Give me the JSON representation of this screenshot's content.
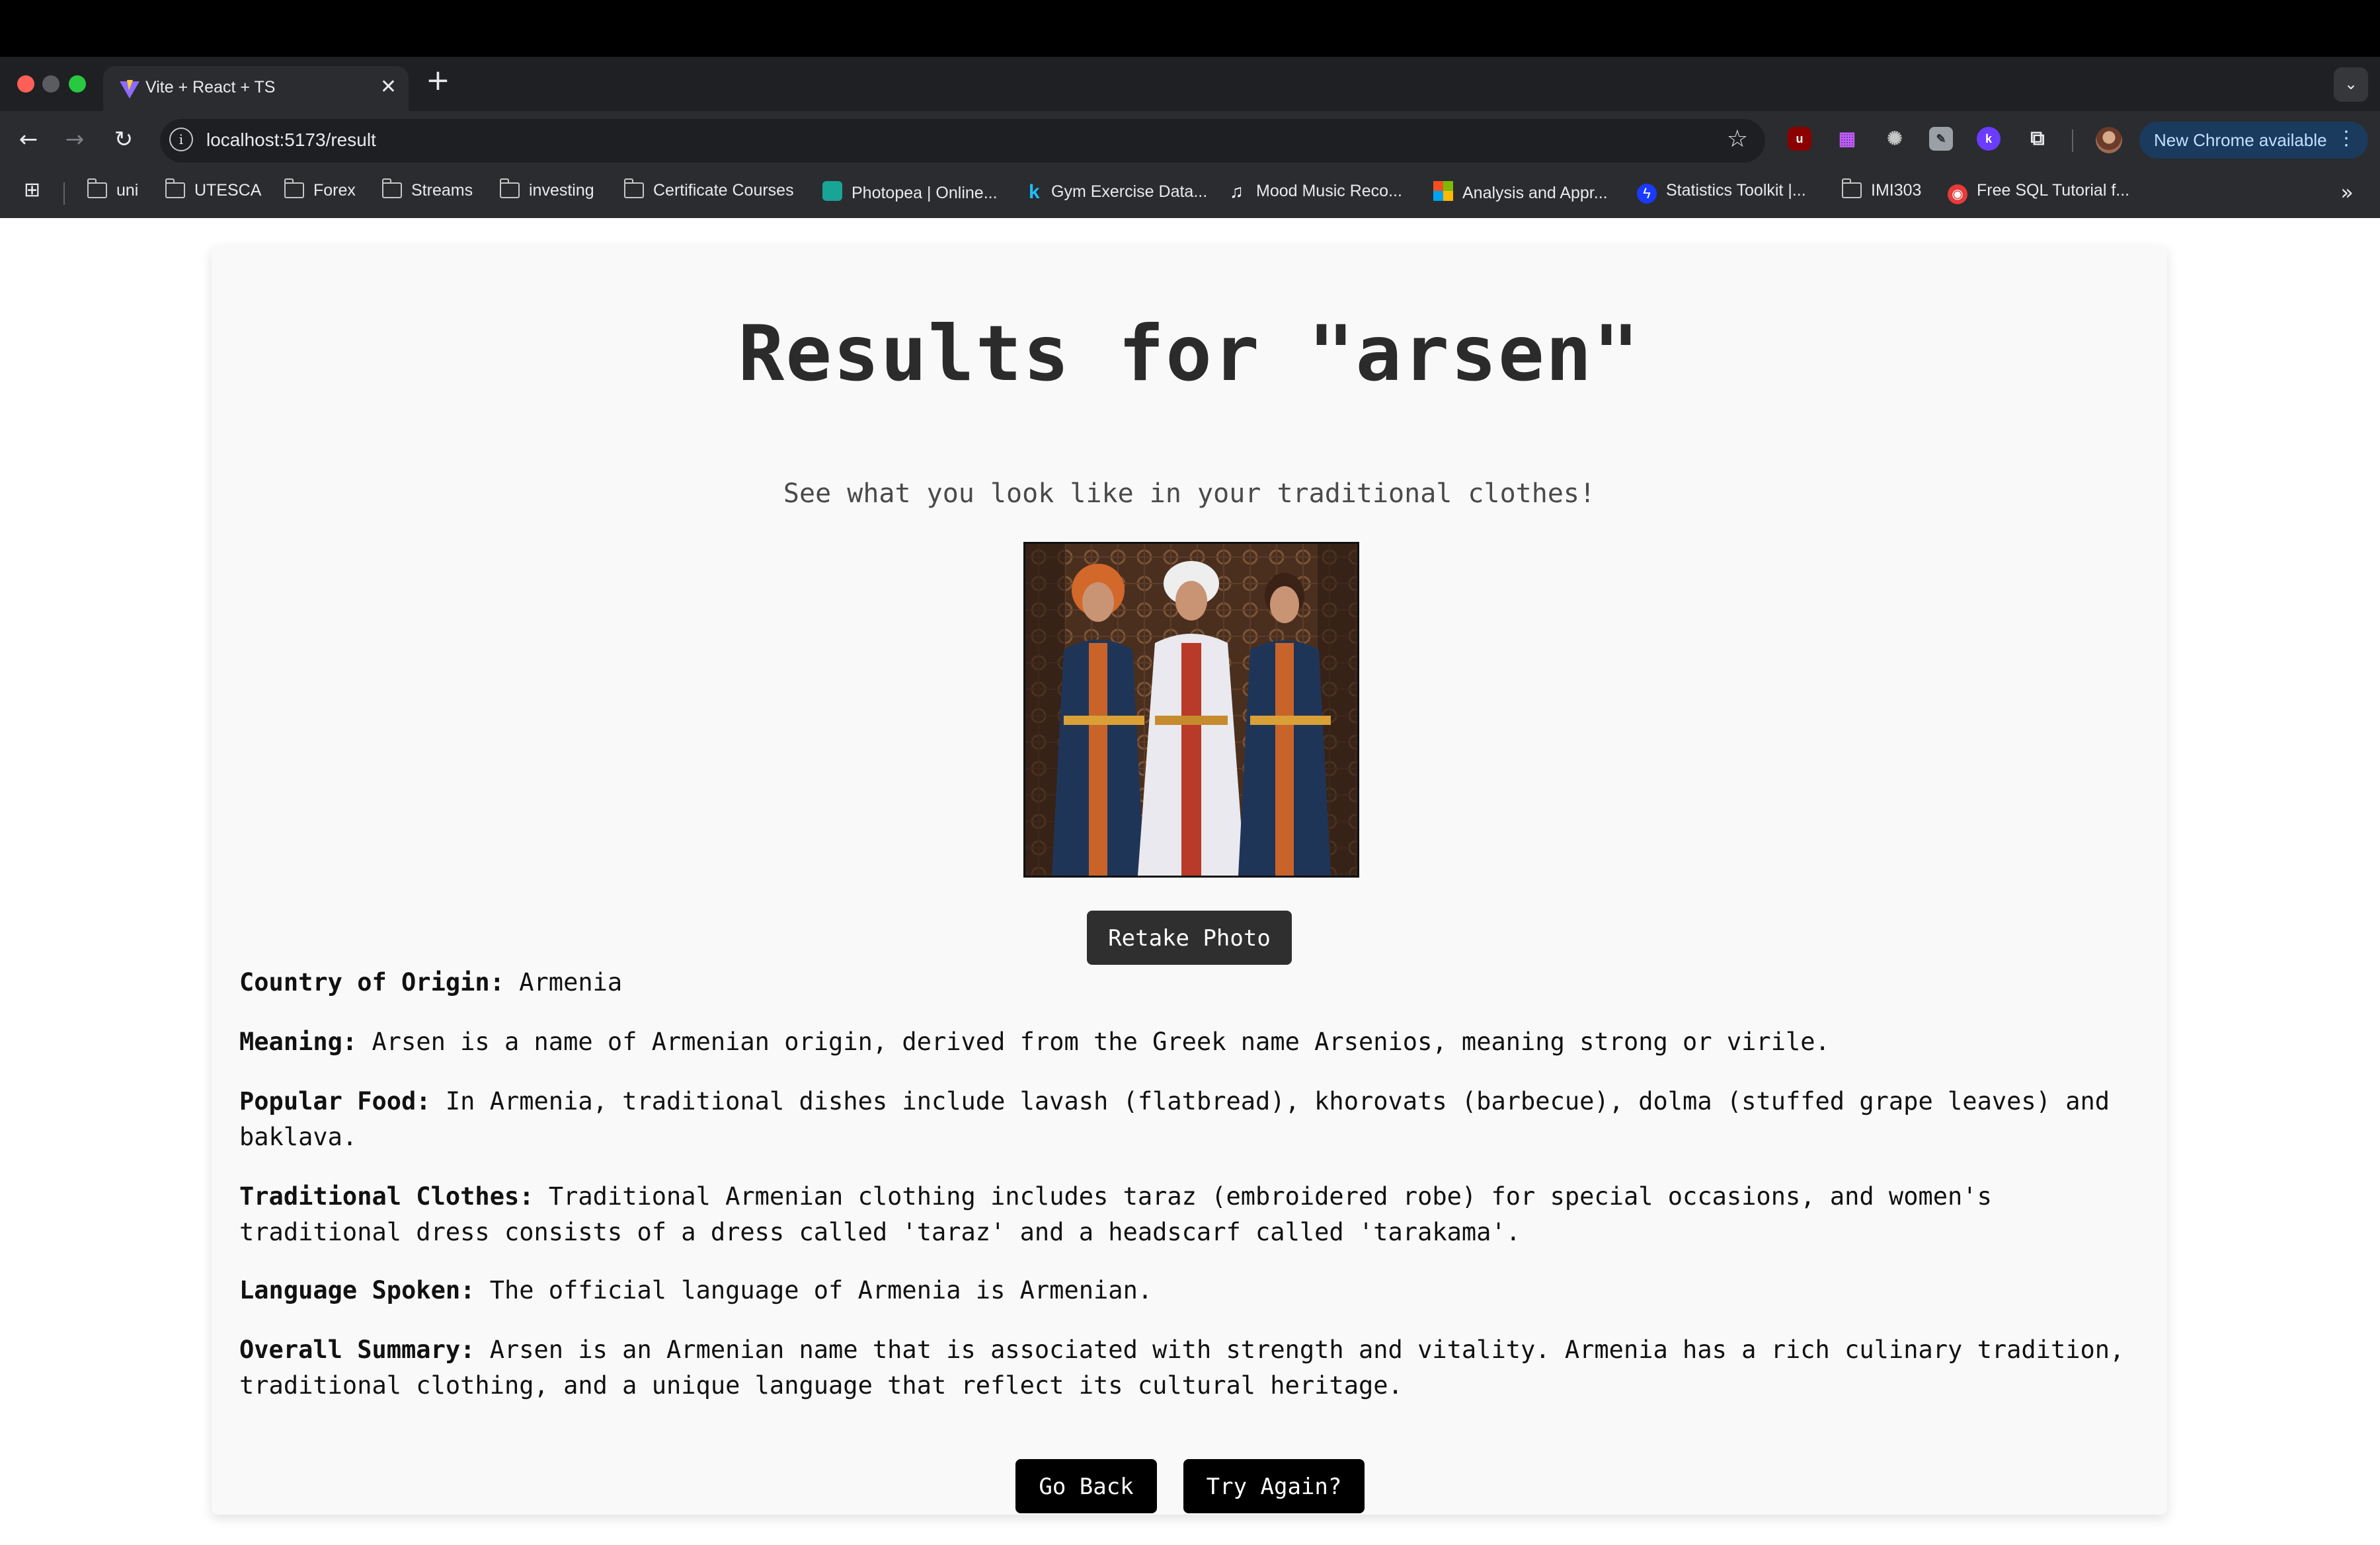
{
  "browser": {
    "tab_title": "Vite + React + TS",
    "url": "localhost:5173/result",
    "new_chrome_label": "New Chrome available",
    "bookmarks": [
      {
        "label": "uni",
        "icon": "folder-icon"
      },
      {
        "label": "UTESCA",
        "icon": "folder-icon"
      },
      {
        "label": "Forex",
        "icon": "folder-icon"
      },
      {
        "label": "Streams",
        "icon": "folder-icon"
      },
      {
        "label": "investing",
        "icon": "folder-icon"
      },
      {
        "label": "Certificate Courses",
        "icon": "folder-icon"
      },
      {
        "label": "Photopea | Online...",
        "icon": "photopea-icon"
      },
      {
        "label": "Gym Exercise Data...",
        "icon": "kaggle-icon"
      },
      {
        "label": "Mood Music Reco...",
        "icon": "music-icon"
      },
      {
        "label": "Analysis and Appr...",
        "icon": "microsoft-icon"
      },
      {
        "label": "Statistics Toolkit |...",
        "icon": "bolt-icon"
      },
      {
        "label": "IMI303",
        "icon": "folder-icon"
      },
      {
        "label": "Free SQL Tutorial f...",
        "icon": "sql-icon"
      }
    ]
  },
  "page": {
    "title": "Results for \"arsen\"",
    "subtitle": "See what you look like in your traditional clothes!",
    "retake_label": "Retake Photo",
    "fields": [
      {
        "label": "Country of Origin:",
        "value": "Armenia"
      },
      {
        "label": "Meaning:",
        "value": "Arsen is a name of Armenian origin, derived from the Greek name Arsenios, meaning strong or virile."
      },
      {
        "label": "Popular Food:",
        "value": "In Armenia, traditional dishes include lavash (flatbread), khorovats (barbecue), dolma (stuffed grape leaves) and baklava."
      },
      {
        "label": "Traditional Clothes:",
        "value": "Traditional Armenian clothing includes taraz (embroidered robe) for special occasions, and women's traditional dress consists of a dress called 'taraz' and a headscarf called 'tarakama'."
      },
      {
        "label": "Language Spoken:",
        "value": "The official language of Armenia is Armenian."
      },
      {
        "label": "Overall Summary:",
        "value": "Arsen is an Armenian name that is associated with strength and vitality. Armenia has a rich culinary tradition, traditional clothing, and a unique language that reflect its cultural heritage."
      }
    ],
    "go_back_label": "Go Back",
    "try_again_label": "Try Again?"
  },
  "colors": {
    "card_bg": "#f9f9f9",
    "button_dark": "#2f2f2f",
    "button_black": "#000000",
    "chrome_bg": "#2a2c2f",
    "new_chrome_bg": "#1a3a5e"
  }
}
